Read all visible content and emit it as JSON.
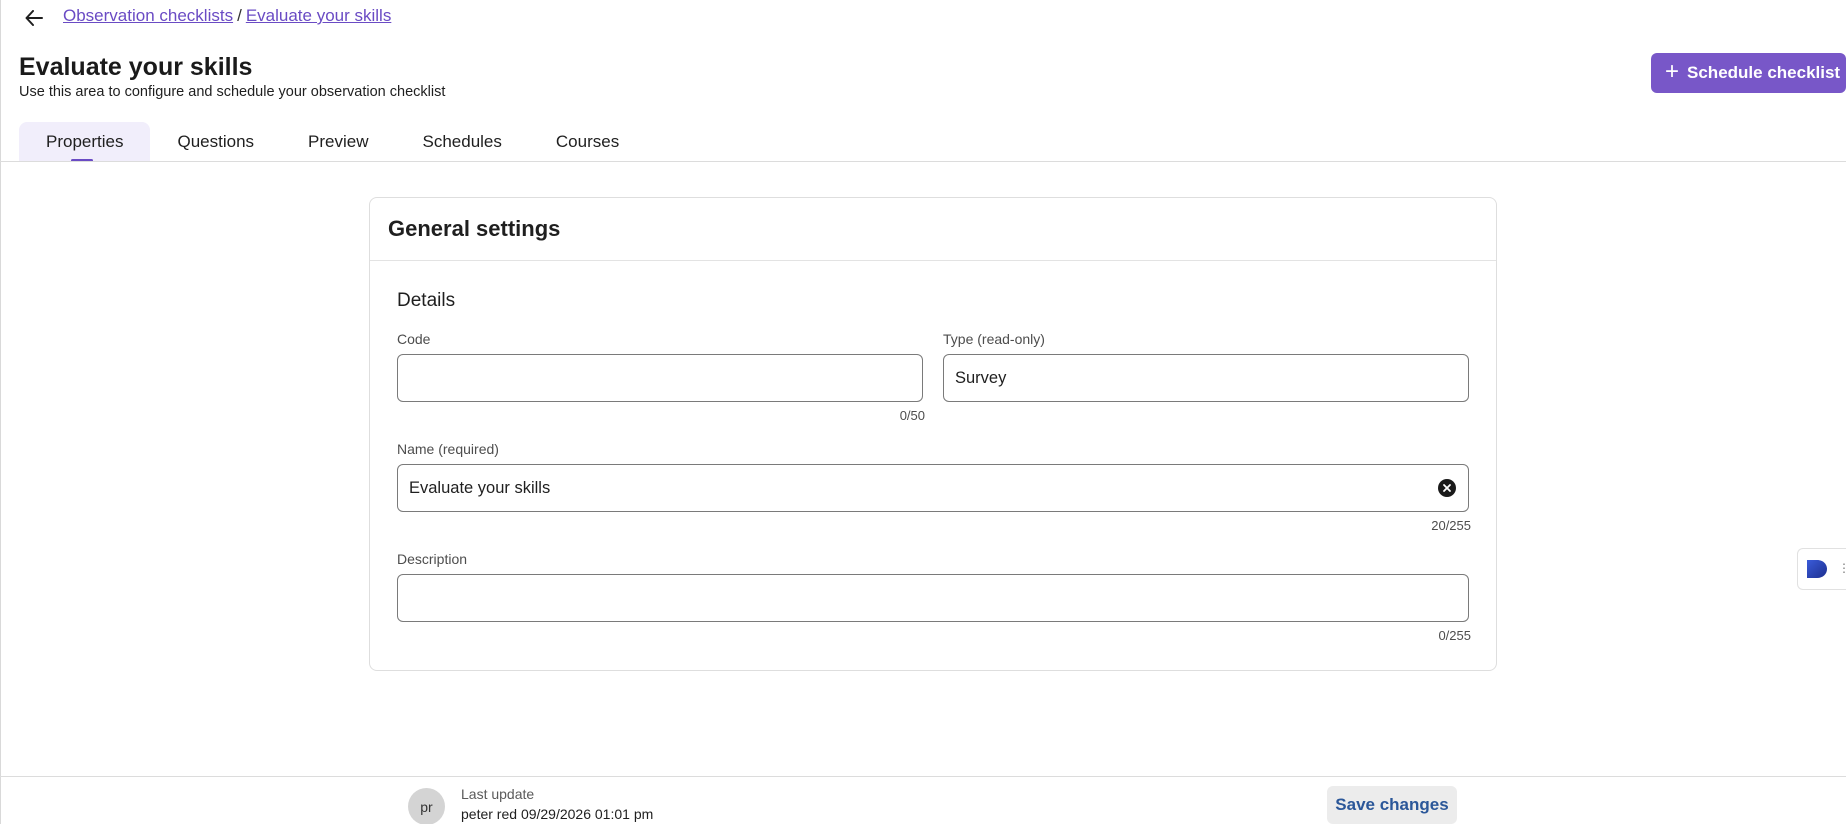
{
  "breadcrumb": {
    "items": [
      "Observation checklists",
      "Evaluate your skills"
    ],
    "separator": "/"
  },
  "header": {
    "title": "Evaluate your skills",
    "subtitle": "Use this area to configure and schedule your observation checklist",
    "schedule_button": "Schedule checklist"
  },
  "tabs": [
    {
      "label": "Properties",
      "active": true
    },
    {
      "label": "Questions",
      "active": false
    },
    {
      "label": "Preview",
      "active": false
    },
    {
      "label": "Schedules",
      "active": false
    },
    {
      "label": "Courses",
      "active": false
    }
  ],
  "card": {
    "title": "General settings",
    "section_title": "Details",
    "code": {
      "label": "Code",
      "value": "",
      "counter": "0/50"
    },
    "type": {
      "label": "Type (read-only)",
      "value": "Survey"
    },
    "name": {
      "label": "Name (required)",
      "value": "Evaluate your skills",
      "counter": "20/255"
    },
    "description": {
      "label": "Description",
      "value": "",
      "counter": "0/255"
    }
  },
  "footer": {
    "avatar_initials": "pr",
    "last_update_label": "Last update",
    "last_update_user": "peter red",
    "last_update_time": "09/29/2026 01:01 pm",
    "save_button": "Save changes"
  },
  "colors": {
    "accent": "#7857c8",
    "link": "#6a4bc4",
    "save_text": "#2b5799"
  },
  "icons": {
    "back": "arrow-left-icon",
    "plus": "plus-icon",
    "clear": "clear-circle-icon"
  }
}
